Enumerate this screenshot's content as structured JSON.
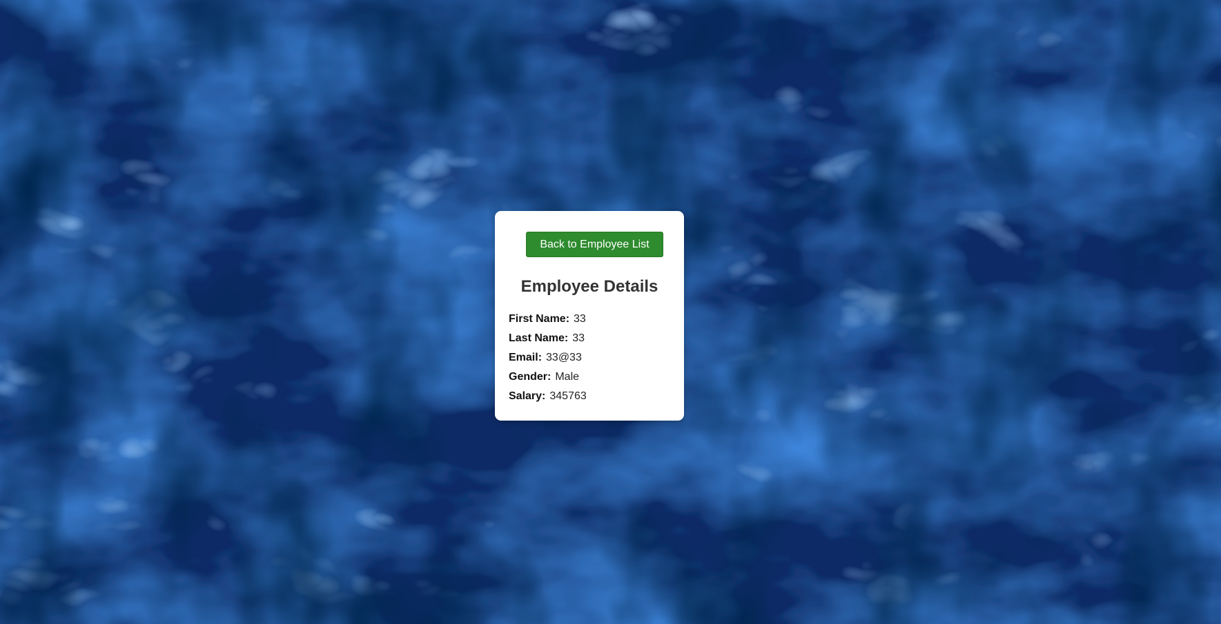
{
  "colors": {
    "background": "#0a2a5e",
    "card": "#ffffff",
    "button": "#2e8b2e",
    "button_text": "#ffffff",
    "title": "#333333"
  },
  "nav": {
    "back_label": "Back to Employee List"
  },
  "page": {
    "title": "Employee Details"
  },
  "employee": {
    "first_name": {
      "label": "First Name:",
      "value": "33"
    },
    "last_name": {
      "label": "Last Name:",
      "value": "33"
    },
    "email": {
      "label": "Email:",
      "value": "33@33"
    },
    "gender": {
      "label": "Gender:",
      "value": "Male"
    },
    "salary": {
      "label": "Salary:",
      "value": "345763"
    }
  }
}
